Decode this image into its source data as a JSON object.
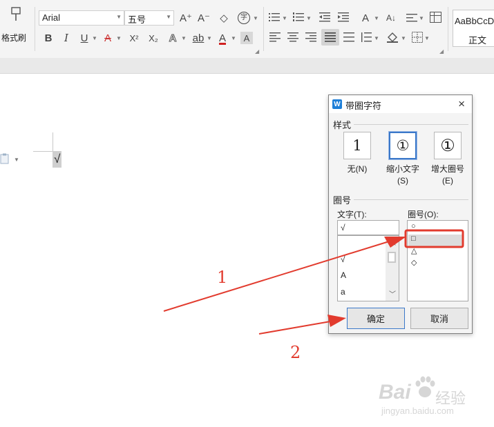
{
  "ribbon": {
    "format_painter_label": "格式刷",
    "font_name": "Arial",
    "font_size": "五号",
    "style_preview": "AaBbCcDd",
    "style_name": "正文",
    "icons": {
      "grow_font": "A⁺",
      "shrink_font": "A⁻",
      "clear_format": "◇",
      "enclosed_char": "字",
      "bold": "B",
      "italic": "I",
      "underline": "U",
      "strike": "A",
      "superscript": "X²",
      "subscript": "X₂",
      "text_effect": "A",
      "highlight": "ab",
      "font_color": "A",
      "char_shade": "A"
    }
  },
  "document": {
    "content_char": "√"
  },
  "dialog": {
    "title": "带圈字符",
    "style_section": "样式",
    "styles": [
      {
        "glyph": "1",
        "label_line1": "无(N)",
        "label_line2": ""
      },
      {
        "glyph": "①",
        "label_line1": "缩小文字",
        "label_line2": "(S)"
      },
      {
        "glyph": "①",
        "label_line1": "增大圈号",
        "label_line2": "(E)"
      }
    ],
    "enclosure_section": "圈号",
    "text_label": "文字(T):",
    "text_value": "√",
    "text_list": [
      "√",
      "A",
      "a"
    ],
    "enclosure_label": "圈号(O):",
    "enclosure_list": [
      "○",
      "□",
      "△",
      "◇"
    ],
    "selected_enclosure": "□",
    "ok_label": "确定",
    "cancel_label": "取消",
    "close_icon": "×"
  },
  "annotations": {
    "label_1": "1",
    "label_2": "2",
    "color": "#e23b2e"
  },
  "watermark": {
    "brand": "Bai",
    "brand_cn": "经验",
    "url": "jingyan.baidu.com"
  }
}
